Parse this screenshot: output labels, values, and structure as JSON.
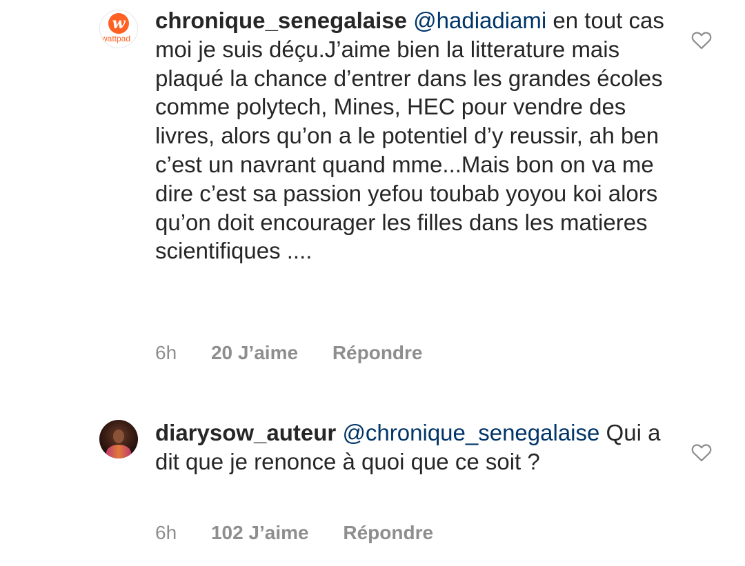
{
  "comments": [
    {
      "avatar_icon": "wattpad-logo-icon",
      "avatar_brand": "wattpad",
      "username": "chronique_senegalaise",
      "mention": "@hadiadiami",
      "text": " en tout cas moi je suis déçu.J’aime bien la litterature mais plaqué la chance d’entrer dans les grandes écoles comme polytech, Mines, HEC pour vendre des livres, alors qu’on a le potentiel d’y reussir, ah ben c’est un navrant quand mme...Mais bon on va me dire c’est sa passion yefou toubab yoyou koi alors qu’on doit encourager les filles dans les matieres scientifiques ....",
      "time": "6h",
      "likes": "20 J’aime",
      "reply": "Répondre"
    },
    {
      "avatar_icon": "user-photo-icon",
      "username": "diarysow_auteur",
      "mention": "@chronique_senegalaise",
      "text": " Qui a dit que je renonce à quoi que ce soit ?",
      "time": "6h",
      "likes": "102 J’aime",
      "reply": "Répondre"
    }
  ],
  "icons": {
    "like": "heart-outline-icon"
  },
  "colors": {
    "text": "#262626",
    "mention": "#003569",
    "meta": "#8e8e8e",
    "wattpad": "#ff6122"
  }
}
